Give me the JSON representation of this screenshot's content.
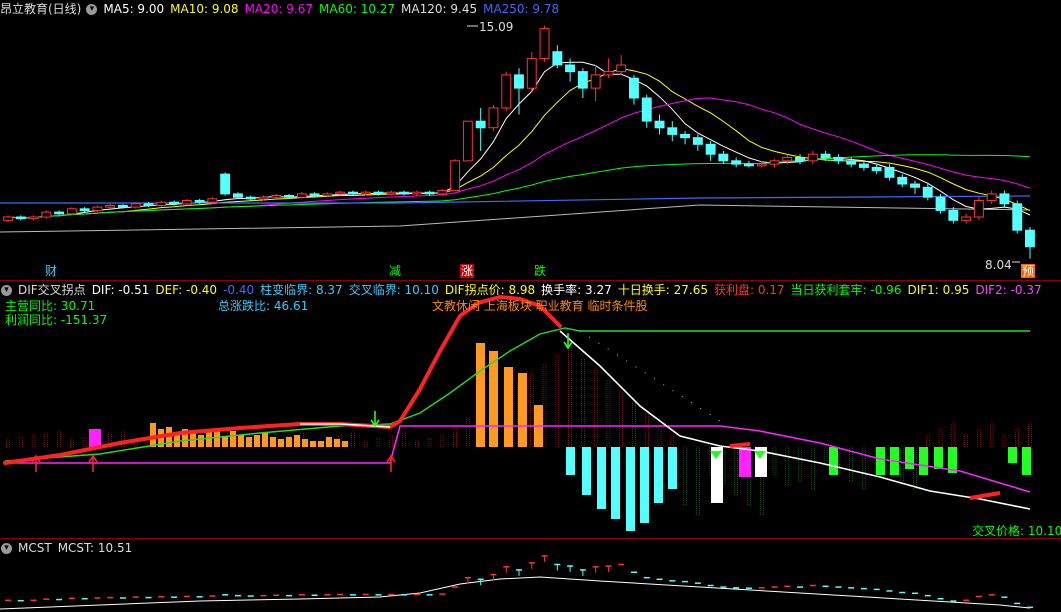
{
  "panel1": {
    "title": "昂立教育(日线)",
    "ma_items": [
      {
        "label": "MA5: 9.00",
        "color": "#ffffff"
      },
      {
        "label": "MA10: 9.08",
        "color": "#ffff00"
      },
      {
        "label": "MA20: 9.67",
        "color": "#ff00ff"
      },
      {
        "label": "MA60: 10.27",
        "color": "#00ff00"
      },
      {
        "label": "MA120: 9.45",
        "color": "#dddddd"
      },
      {
        "label": "MA250: 9.78",
        "color": "#3a6cff"
      }
    ],
    "high_label": "15.09",
    "low_label": "8.04",
    "markers": [
      {
        "text": "财",
        "bg": "#000000",
        "color": "#33ccff"
      },
      {
        "text": "减",
        "bg": "#000000",
        "color": "#00ff00"
      },
      {
        "text": "涨",
        "bg": "#cc0000",
        "color": "#ffffff"
      },
      {
        "text": "跌",
        "bg": "#000000",
        "color": "#00ff00"
      },
      {
        "text": "预",
        "bg": "#ff6600",
        "color": "#ffffff"
      }
    ],
    "candle_summary": [
      {
        "o": 9.2,
        "c": 9.3,
        "h": 9.35,
        "l": 9.15
      },
      {
        "o": 9.3,
        "c": 9.25,
        "h": 9.35,
        "l": 9.2
      },
      {
        "o": 9.25,
        "c": 9.3,
        "h": 9.35,
        "l": 9.2
      },
      {
        "o": 9.3,
        "c": 9.45,
        "h": 9.5,
        "l": 9.25
      },
      {
        "o": 9.45,
        "c": 9.4,
        "h": 9.5,
        "l": 9.35
      },
      {
        "o": 9.4,
        "c": 9.55,
        "h": 9.6,
        "l": 9.35
      },
      {
        "o": 9.55,
        "c": 9.5,
        "h": 9.6,
        "l": 9.45
      },
      {
        "o": 9.5,
        "c": 9.6,
        "h": 9.65,
        "l": 9.45
      },
      {
        "o": 9.6,
        "c": 9.65,
        "h": 9.7,
        "l": 9.55
      },
      {
        "o": 9.65,
        "c": 9.6,
        "h": 9.7,
        "l": 9.55
      },
      {
        "o": 9.6,
        "c": 9.7,
        "h": 9.75,
        "l": 9.55
      },
      {
        "o": 9.7,
        "c": 9.65,
        "h": 9.75,
        "l": 9.6
      },
      {
        "o": 9.65,
        "c": 9.75,
        "h": 9.8,
        "l": 9.6
      },
      {
        "o": 9.75,
        "c": 9.7,
        "h": 9.8,
        "l": 9.65
      },
      {
        "o": 9.7,
        "c": 9.8,
        "h": 9.85,
        "l": 9.65
      },
      {
        "o": 9.8,
        "c": 9.75,
        "h": 9.85,
        "l": 9.7
      },
      {
        "o": 9.75,
        "c": 9.85,
        "h": 9.9,
        "l": 9.7
      },
      {
        "o": 10.6,
        "c": 10.0,
        "h": 10.65,
        "l": 9.95
      },
      {
        "o": 10.0,
        "c": 9.9,
        "h": 10.05,
        "l": 9.85
      },
      {
        "o": 9.9,
        "c": 9.85,
        "h": 9.95,
        "l": 9.8
      },
      {
        "o": 9.85,
        "c": 9.9,
        "h": 9.95,
        "l": 9.8
      },
      {
        "o": 9.9,
        "c": 9.95,
        "h": 10.0,
        "l": 9.85
      },
      {
        "o": 9.95,
        "c": 9.9,
        "h": 10.0,
        "l": 9.85
      },
      {
        "o": 9.9,
        "c": 10.0,
        "h": 10.05,
        "l": 9.85
      },
      {
        "o": 10.0,
        "c": 9.95,
        "h": 10.05,
        "l": 9.9
      },
      {
        "o": 9.95,
        "c": 10.0,
        "h": 10.05,
        "l": 9.9
      },
      {
        "o": 10.0,
        "c": 10.05,
        "h": 10.1,
        "l": 9.95
      },
      {
        "o": 10.05,
        "c": 10.0,
        "h": 10.1,
        "l": 9.95
      },
      {
        "o": 10.0,
        "c": 10.05,
        "h": 10.1,
        "l": 9.95
      },
      {
        "o": 10.05,
        "c": 10.0,
        "h": 10.1,
        "l": 9.95
      },
      {
        "o": 10.0,
        "c": 10.05,
        "h": 10.1,
        "l": 9.95
      },
      {
        "o": 10.05,
        "c": 10.0,
        "h": 10.1,
        "l": 9.95
      },
      {
        "o": 10.0,
        "c": 10.05,
        "h": 10.1,
        "l": 9.95
      },
      {
        "o": 10.05,
        "c": 10.0,
        "h": 10.1,
        "l": 9.95
      },
      {
        "o": 10.0,
        "c": 10.1,
        "h": 10.15,
        "l": 9.95
      },
      {
        "o": 10.1,
        "c": 11.0,
        "h": 11.05,
        "l": 10.1
      },
      {
        "o": 11.0,
        "c": 12.2,
        "h": 12.2,
        "l": 11.0
      },
      {
        "o": 12.2,
        "c": 12.0,
        "h": 12.6,
        "l": 11.3
      },
      {
        "o": 12.0,
        "c": 12.6,
        "h": 12.7,
        "l": 11.9
      },
      {
        "o": 12.6,
        "c": 13.6,
        "h": 13.7,
        "l": 12.5
      },
      {
        "o": 13.6,
        "c": 13.2,
        "h": 13.8,
        "l": 12.4
      },
      {
        "o": 13.2,
        "c": 14.1,
        "h": 14.3,
        "l": 13.1
      },
      {
        "o": 14.1,
        "c": 15.0,
        "h": 15.09,
        "l": 14.0
      },
      {
        "o": 14.3,
        "c": 13.9,
        "h": 14.5,
        "l": 13.8
      },
      {
        "o": 13.9,
        "c": 13.7,
        "h": 14.1,
        "l": 13.4
      },
      {
        "o": 13.7,
        "c": 13.2,
        "h": 13.8,
        "l": 12.9
      },
      {
        "o": 13.2,
        "c": 13.6,
        "h": 13.9,
        "l": 12.8
      },
      {
        "o": 13.6,
        "c": 13.7,
        "h": 14.1,
        "l": 13.5
      },
      {
        "o": 13.7,
        "c": 13.9,
        "h": 14.2,
        "l": 13.6
      },
      {
        "o": 13.5,
        "c": 12.9,
        "h": 13.6,
        "l": 12.7
      },
      {
        "o": 12.9,
        "c": 12.2,
        "h": 13.0,
        "l": 12.0
      },
      {
        "o": 12.2,
        "c": 12.0,
        "h": 12.4,
        "l": 11.8
      },
      {
        "o": 12.0,
        "c": 11.8,
        "h": 12.2,
        "l": 11.6
      },
      {
        "o": 11.8,
        "c": 11.7,
        "h": 11.9,
        "l": 11.5
      },
      {
        "o": 11.7,
        "c": 11.5,
        "h": 11.8,
        "l": 11.3
      },
      {
        "o": 11.5,
        "c": 11.2,
        "h": 11.6,
        "l": 11.0
      },
      {
        "o": 11.2,
        "c": 11.0,
        "h": 11.3,
        "l": 10.9
      },
      {
        "o": 11.0,
        "c": 10.9,
        "h": 11.1,
        "l": 10.8
      },
      {
        "o": 10.9,
        "c": 10.85,
        "h": 11.0,
        "l": 10.8
      },
      {
        "o": 10.85,
        "c": 10.9,
        "h": 11.0,
        "l": 10.8
      },
      {
        "o": 10.9,
        "c": 11.0,
        "h": 11.05,
        "l": 10.8
      },
      {
        "o": 11.0,
        "c": 11.1,
        "h": 11.2,
        "l": 10.9
      },
      {
        "o": 11.1,
        "c": 11.0,
        "h": 11.2,
        "l": 10.9
      },
      {
        "o": 11.0,
        "c": 11.2,
        "h": 11.3,
        "l": 10.9
      },
      {
        "o": 11.2,
        "c": 11.1,
        "h": 11.3,
        "l": 11.0
      },
      {
        "o": 11.1,
        "c": 11.0,
        "h": 11.2,
        "l": 10.9
      },
      {
        "o": 11.0,
        "c": 10.9,
        "h": 11.1,
        "l": 10.8
      },
      {
        "o": 10.9,
        "c": 10.8,
        "h": 11.0,
        "l": 10.7
      },
      {
        "o": 10.8,
        "c": 10.7,
        "h": 10.9,
        "l": 10.6
      },
      {
        "o": 10.8,
        "c": 10.5,
        "h": 10.9,
        "l": 10.4
      },
      {
        "o": 10.5,
        "c": 10.3,
        "h": 10.6,
        "l": 10.2
      },
      {
        "o": 10.3,
        "c": 10.2,
        "h": 10.4,
        "l": 10.0
      },
      {
        "o": 10.2,
        "c": 9.9,
        "h": 10.3,
        "l": 9.8
      },
      {
        "o": 9.9,
        "c": 9.5,
        "h": 10.0,
        "l": 9.4
      },
      {
        "o": 9.5,
        "c": 9.2,
        "h": 9.6,
        "l": 9.1
      },
      {
        "o": 9.2,
        "c": 9.3,
        "h": 9.4,
        "l": 9.1
      },
      {
        "o": 9.3,
        "c": 9.8,
        "h": 9.9,
        "l": 9.2
      },
      {
        "o": 9.8,
        "c": 10.0,
        "h": 10.1,
        "l": 9.7
      },
      {
        "o": 10.0,
        "c": 9.7,
        "h": 10.1,
        "l": 9.6
      },
      {
        "o": 9.7,
        "c": 8.9,
        "h": 9.8,
        "l": 8.8
      },
      {
        "o": 8.9,
        "c": 8.4,
        "h": 9.0,
        "l": 8.04
      }
    ]
  },
  "panel2": {
    "title": "DIF交叉拐点",
    "items": [
      {
        "label": "DIF: -0.51",
        "color": "#ffffff"
      },
      {
        "label": "DEF: -0.40",
        "color": "#ffff00"
      },
      {
        "label": "-0.40",
        "color": "#3a6cff"
      },
      {
        "label": "柱变临界: 8.37",
        "color": "#33ccff"
      },
      {
        "label": "交叉临界: 10.10",
        "color": "#33ccff"
      },
      {
        "label": "DIF拐点价: 8.98",
        "color": "#ffff00"
      },
      {
        "label": "换手率: 3.27",
        "color": "#ffffff"
      },
      {
        "label": "十日换手: 27.65",
        "color": "#ffff00"
      },
      {
        "label": "获利盘: 0.17",
        "color": "#ff3333"
      },
      {
        "label": "当日获利套牢: -0.96",
        "color": "#00ff00"
      },
      {
        "label": "DIF1: 0.95",
        "color": "#ffff00"
      },
      {
        "label": "DIF2: -0.37",
        "color": "#ff44ff"
      }
    ],
    "main_yoy": "主营同比: 30.71",
    "profit_yoy": "利润同比: -151.37",
    "total_change": "总涨跌比: 46.61",
    "concept": "文教休闲 上海板块 职业教育 临时条件股",
    "cross_price": "交叉价格: 10.10"
  },
  "panel3": {
    "title": "MCST",
    "value": "MCST: 10.51"
  },
  "colors": {
    "up": "#ff3333",
    "down": "#54ffff",
    "separator": "#8b0000"
  }
}
